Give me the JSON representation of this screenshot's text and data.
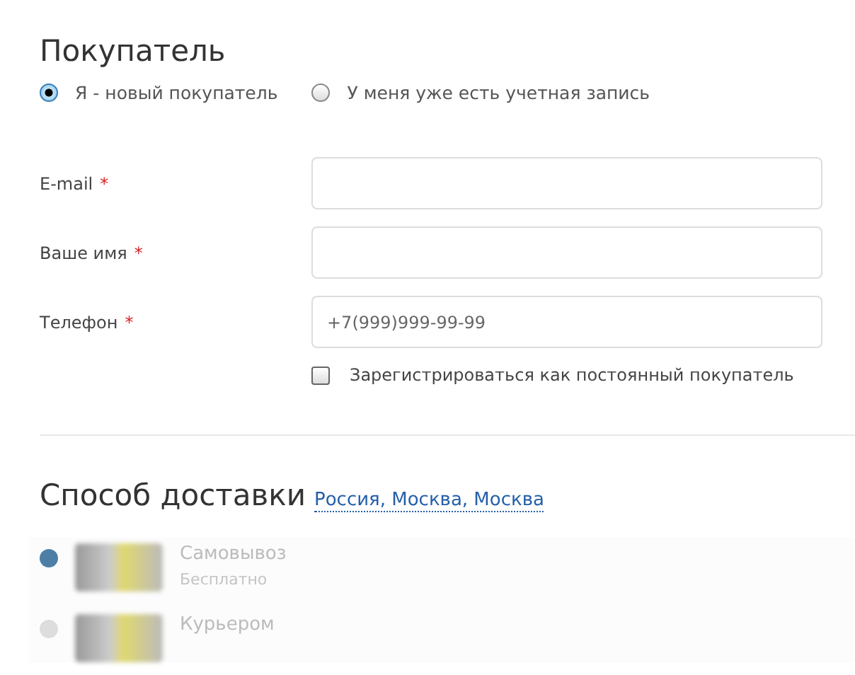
{
  "buyer": {
    "title": "Покупатель",
    "types": [
      {
        "label": "Я - новый покупатель",
        "selected": true
      },
      {
        "label": "У меня уже есть учетная запись",
        "selected": false
      }
    ],
    "fields": [
      {
        "label": "E-mail",
        "required_mark": "*"
      },
      {
        "label": "Ваше имя",
        "required_mark": "*"
      },
      {
        "label": "Телефон",
        "required_mark": "*",
        "placeholder": "+7(999)999-99-99"
      }
    ],
    "register": {
      "label": "Зарегистрироваться как постоянный покупатель",
      "checked": false
    }
  },
  "delivery": {
    "title": "Способ доставки",
    "location": "Россия, Москва, Москва",
    "options": [
      {
        "name": "Самовывоз",
        "price": "Бесплатно",
        "selected": true
      },
      {
        "name": "Курьером",
        "selected": false
      }
    ]
  }
}
